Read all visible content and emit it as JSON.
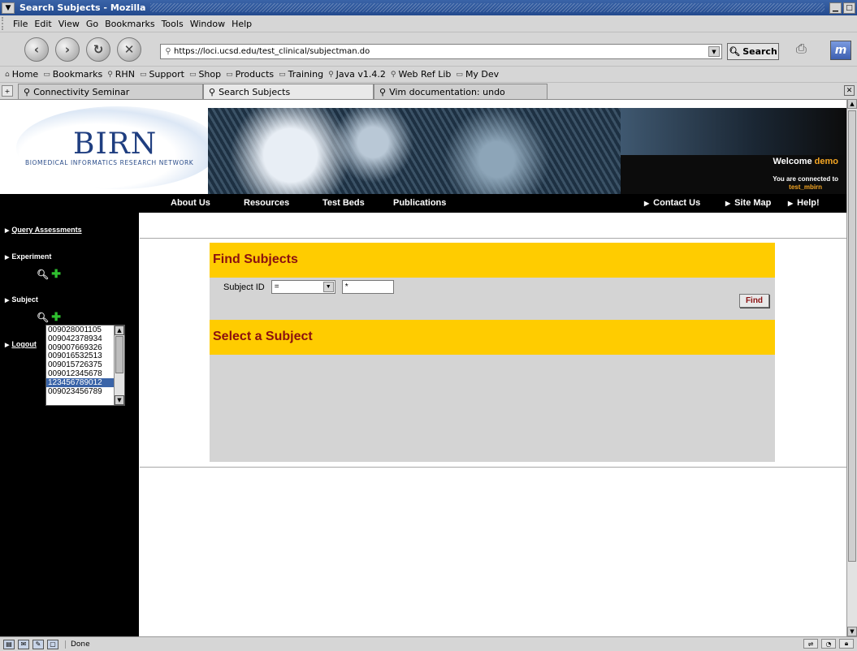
{
  "window": {
    "title": "Search Subjects - Mozilla"
  },
  "menu": [
    "File",
    "Edit",
    "View",
    "Go",
    "Bookmarks",
    "Tools",
    "Window",
    "Help"
  ],
  "navbar": {
    "url": "https://loci.ucsd.edu/test_clinical/subjectman.do",
    "search_label": "Search"
  },
  "bookmarks": [
    "Home",
    "Bookmarks",
    "RHN",
    "Support",
    "Shop",
    "Products",
    "Training",
    "Java v1.4.2",
    "Web Ref Lib",
    "My Dev"
  ],
  "tabs": [
    {
      "label": "Connectivity Seminar",
      "active": false
    },
    {
      "label": "Search Subjects",
      "active": true
    },
    {
      "label": "Vim documentation: undo",
      "active": false
    }
  ],
  "banner": {
    "logo_text": "BIRN",
    "logo_subtitle": "BIOMEDICAL INFORMATICS RESEARCH NETWORK",
    "welcome_text": "Welcome",
    "user": "demo",
    "connected_text": "You are connected to",
    "database": "test_mbirn"
  },
  "topnav": {
    "items": [
      "About Us",
      "Resources",
      "Test Beds",
      "Publications"
    ],
    "right_items": [
      "Contact Us",
      "Site Map",
      "Help!"
    ]
  },
  "sidebar": {
    "query_assessments": "Query Assessments",
    "experiment": "Experiment",
    "subject": "Subject",
    "logout": "Logout"
  },
  "find": {
    "heading": "Find Subjects",
    "subject_id_label": "Subject ID",
    "operator": "=",
    "value": "*",
    "button": "Find"
  },
  "select": {
    "heading": "Select a Subject",
    "options": [
      "009028001105",
      "009042378934",
      "009007669326",
      "009016532513",
      "009015726375",
      "009012345678",
      "123456789012",
      "009023456789"
    ],
    "selected": "123456789012"
  },
  "status": {
    "text": "Done"
  },
  "colors": {
    "accent": "#ffcc00",
    "heading_text": "#8b1010",
    "user_highlight": "#f5a623"
  }
}
